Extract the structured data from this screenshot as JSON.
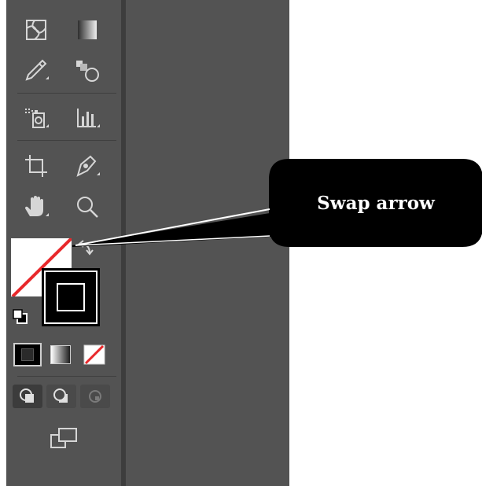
{
  "toolbar": {
    "tools": [
      {
        "name": "mesh-tool-icon"
      },
      {
        "name": "gradient-tool-icon"
      },
      {
        "name": "eyedropper-tool-icon"
      },
      {
        "name": "blend-tool-icon"
      },
      {
        "name": "symbol-sprayer-tool-icon"
      },
      {
        "name": "column-graph-tool-icon"
      },
      {
        "name": "artboard-tool-icon"
      },
      {
        "name": "slice-tool-icon"
      },
      {
        "name": "hand-tool-icon"
      },
      {
        "name": "zoom-tool-icon"
      }
    ],
    "fill_stroke": {
      "fill": "none",
      "stroke_color": "#000000",
      "swap_icon": "swap-arrow-icon",
      "default_icon": "default-fill-stroke-icon"
    },
    "color_modes": [
      "color-icon",
      "gradient-icon",
      "none-icon"
    ],
    "draw_modes": [
      "draw-normal-icon",
      "draw-behind-icon",
      "draw-inside-icon"
    ],
    "screen_mode_icon": "change-screen-mode-icon"
  },
  "callout": {
    "label": "Swap arrow",
    "background": "#000000",
    "text_color": "#ffffff"
  },
  "colors": {
    "panel": "#535353",
    "icon": "#d6d6d6",
    "none_red": "#e8282b"
  }
}
